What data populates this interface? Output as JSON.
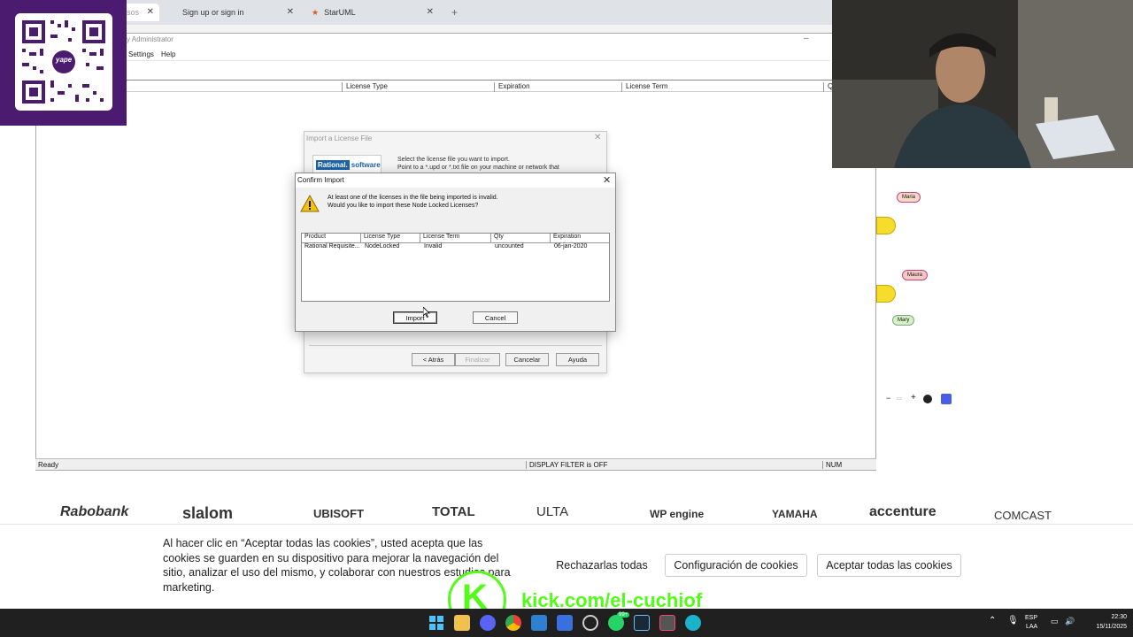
{
  "browser": {
    "tabs": [
      {
        "label": "asos",
        "active": true
      },
      {
        "label": "Sign up or sign in",
        "active": false
      },
      {
        "label": "StarUML",
        "active": false
      }
    ],
    "new_tab": "+"
  },
  "app": {
    "title": "y Administrator",
    "menu": [
      "Settings",
      "Help"
    ],
    "columns": [
      "License Type",
      "Expiration",
      "License Term",
      "Q"
    ],
    "status": {
      "left": "Ready",
      "filter": "DISPLAY FILTER is OFF",
      "num": "NUM"
    }
  },
  "import_dialog": {
    "title": "Import a License File",
    "logo_a": "Rational.",
    "logo_b": "software",
    "line1": "Select the license file you want to import.",
    "line2": "Point to a *.upd or *.txt file on your machine or network that",
    "buttons": {
      "back": "< Atrás",
      "finish": "Finalizar",
      "cancel": "Cancelar",
      "help": "Ayuda"
    }
  },
  "confirm_dialog": {
    "title": "Confirm Import",
    "message1": "At least one of the licenses in the file being imported is invalid.",
    "message2": "Would you like to import these Node Locked Licenses?",
    "columns": [
      "Product",
      "License Type",
      "License Term",
      "Qty",
      "Expiration"
    ],
    "rows": [
      {
        "product": "Rational Requisite...",
        "type": "NodeLocked",
        "term": "Invalid",
        "qty": "uncounted",
        "expiration": "06-jan-2020"
      }
    ],
    "import_label": "Import",
    "cancel_label": "Cancel"
  },
  "board": {
    "bubbles": [
      "Maria",
      "Maura",
      "Mary"
    ]
  },
  "logos": [
    "Rabobank",
    "slalom",
    "UBISOFT",
    "TOTAL",
    "ULTA",
    "WP engine",
    "YAMAHA",
    "accenture",
    "COMCAST"
  ],
  "cookies": {
    "text": "Al hacer clic en “Aceptar todas las cookies”, usted acepta que las cookies se guarden en su dispositivo para mejorar la navegación del sitio, analizar el uso del mismo, y colaborar con nuestros estudios para marketing.",
    "reject": "Rechazarlas todas",
    "config": "Configuración de cookies",
    "accept": "Aceptar todas las cookies"
  },
  "kick": {
    "letter": "K",
    "url": "kick.com/el-cuchiof"
  },
  "qr": {
    "label": "yape"
  },
  "taskbar": {
    "lang1": "ESP",
    "lang2": "LAA",
    "time": "22:30",
    "date": "15/11/2025",
    "badge": "99+"
  },
  "colors": {
    "kick": "#53fc18",
    "qr_bg": "#4a1b6e",
    "rational": "#1c63a8"
  }
}
